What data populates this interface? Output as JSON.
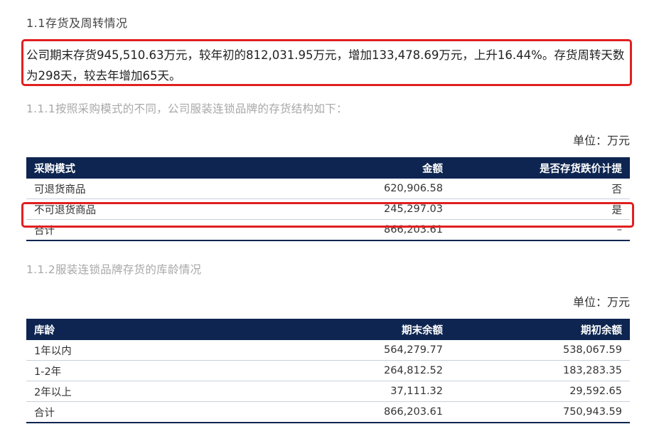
{
  "section_title": "1.1存货及周转情况",
  "summary": "公司期末存货945,510.63万元，较年初的812,031.95万元，增加133,478.69万元，上升16.44%。存货周转天数为298天，较去年增加65天。",
  "sub1_title": "1.1.1按照采购模式的不同，公司服装连锁品牌的存货结构如下：",
  "unit_label": "单位：万元",
  "table1": {
    "headers": [
      "采购模式",
      "金额",
      "是否存货跌价计提"
    ],
    "rows": [
      [
        "可退货商品",
        "620,906.58",
        "否"
      ],
      [
        "不可退货商品",
        "245,297.03",
        "是"
      ],
      [
        "合计",
        "866,203.61",
        "–"
      ]
    ]
  },
  "sub2_title": "1.1.2服装连锁品牌存货的库龄情况",
  "table2": {
    "headers": [
      "库龄",
      "期末余额",
      "期初余额"
    ],
    "rows": [
      [
        "1年以内",
        "564,279.77",
        "538,067.59"
      ],
      [
        "1-2年",
        "264,812.52",
        "183,283.35"
      ],
      [
        "2年以上",
        "37,111.32",
        "29,592.65"
      ],
      [
        "合计",
        "866,203.61",
        "750,943.59"
      ]
    ]
  },
  "colors": {
    "header_bg": "#0d2550",
    "highlight": "#e02020",
    "subtitle": "#a8a8a8"
  }
}
